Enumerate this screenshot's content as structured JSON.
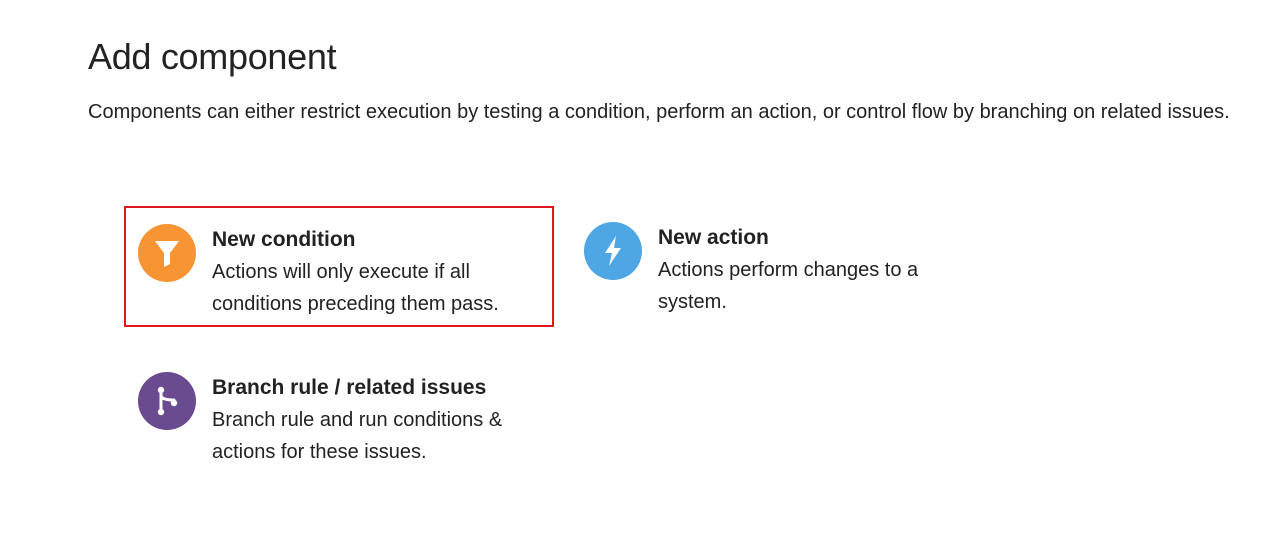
{
  "dialog": {
    "title": "Add component",
    "description": "Components can either restrict execution by testing a condition, perform an action, or control flow by branching on related issues."
  },
  "options": {
    "condition": {
      "title": "New condition",
      "description": "Actions will only execute if all conditions preceding them pass.",
      "icon": "filter-icon",
      "color": "#f79433",
      "highlighted": true,
      "highlight_color": "#e0161b"
    },
    "action": {
      "title": "New action",
      "description": "Actions perform changes to a system.",
      "icon": "lightning-bolt-icon",
      "color": "#4ea7e4"
    },
    "branch": {
      "title": "Branch rule / related issues",
      "description": "Branch rule and run conditions & actions for these issues.",
      "icon": "branch-icon",
      "color": "#6a4b8f"
    }
  }
}
